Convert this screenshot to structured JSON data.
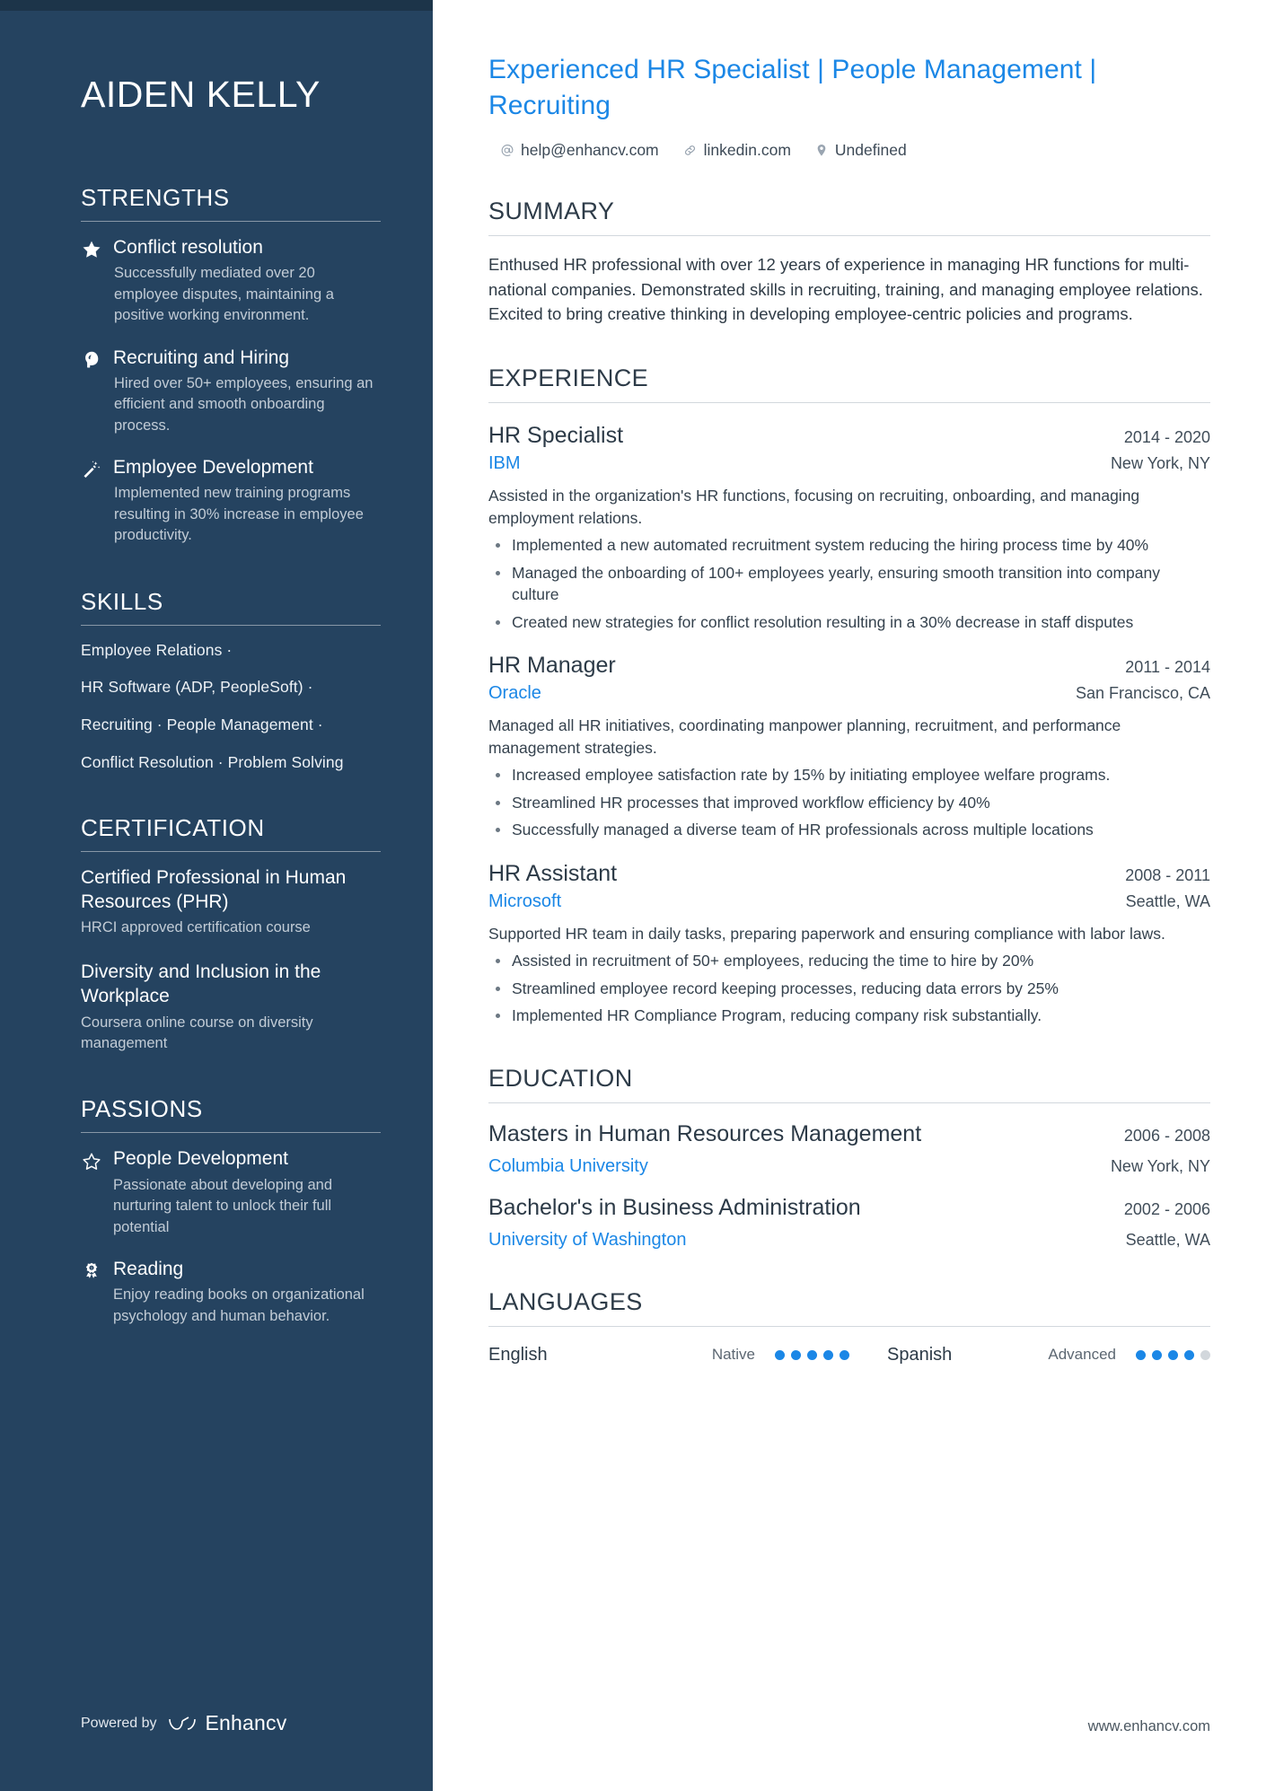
{
  "sidebar": {
    "name": "AIDEN KELLY",
    "strengths": {
      "heading": "STRENGTHS",
      "items": [
        {
          "icon": "star-filled-icon",
          "title": "Conflict resolution",
          "desc": "Successfully mediated over 20 employee disputes, maintaining a positive working environment."
        },
        {
          "icon": "head-brain-icon",
          "title": "Recruiting and Hiring",
          "desc": "Hired over 50+ employees, ensuring an efficient and smooth onboarding process."
        },
        {
          "icon": "magic-wand-icon",
          "title": "Employee Development",
          "desc": "Implemented new training programs resulting in 30% increase in employee productivity."
        }
      ]
    },
    "skills": {
      "heading": "SKILLS",
      "lines": [
        "Employee Relations ·",
        "HR Software (ADP, PeopleSoft) ·",
        "Recruiting · People Management ·",
        "Conflict Resolution · Problem Solving"
      ]
    },
    "certification": {
      "heading": "CERTIFICATION",
      "items": [
        {
          "title": "Certified Professional in Human Resources (PHR)",
          "desc": "HRCI approved certification course"
        },
        {
          "title": "Diversity and Inclusion in the Workplace",
          "desc": "Coursera online course on diversity management"
        }
      ]
    },
    "passions": {
      "heading": "PASSIONS",
      "items": [
        {
          "icon": "star-outline-icon",
          "title": "People Development",
          "desc": "Passionate about developing and nurturing talent to unlock their full potential"
        },
        {
          "icon": "award-ribbon-icon",
          "title": "Reading",
          "desc": "Enjoy reading books on organizational psychology and human behavior."
        }
      ]
    },
    "footer": {
      "powered_by": "Powered by",
      "brand": "Enhancv"
    }
  },
  "main": {
    "headline": "Experienced HR Specialist | People Management | Recruiting",
    "contacts": [
      {
        "icon": "at-icon",
        "text": "help@enhancv.com"
      },
      {
        "icon": "link-icon",
        "text": "linkedin.com"
      },
      {
        "icon": "location-pin-icon",
        "text": "Undefined"
      }
    ],
    "summary": {
      "heading": "SUMMARY",
      "text": "Enthused HR professional with over 12 years of experience in managing HR functions for multi-national companies. Demonstrated skills in recruiting, training, and managing employee relations. Excited to bring creative thinking in developing employee-centric policies and programs."
    },
    "experience": {
      "heading": "EXPERIENCE",
      "entries": [
        {
          "title": "HR Specialist",
          "date": "2014 - 2020",
          "org": "IBM",
          "location": "New York, NY",
          "desc": "Assisted in the organization's HR functions, focusing on recruiting, onboarding, and managing employment relations.",
          "bullets": [
            "Implemented a new automated recruitment system reducing the hiring process time by 40%",
            "Managed the onboarding of 100+ employees yearly, ensuring smooth transition into company culture",
            "Created new strategies for conflict resolution resulting in a 30% decrease in staff disputes"
          ]
        },
        {
          "title": "HR Manager",
          "date": "2011 - 2014",
          "org": "Oracle",
          "location": "San Francisco, CA",
          "desc": "Managed all HR initiatives, coordinating manpower planning, recruitment, and performance management strategies.",
          "bullets": [
            "Increased employee satisfaction rate by 15% by initiating employee welfare programs.",
            "Streamlined HR processes that improved workflow efficiency by 40%",
            "Successfully managed a diverse team of HR professionals across multiple locations"
          ]
        },
        {
          "title": "HR Assistant",
          "date": "2008 - 2011",
          "org": "Microsoft",
          "location": "Seattle, WA",
          "desc": "Supported HR team in daily tasks, preparing paperwork and ensuring compliance with labor laws.",
          "bullets": [
            "Assisted in recruitment of 50+ employees, reducing the time to hire by 20%",
            "Streamlined employee record keeping processes, reducing data errors by 25%",
            "Implemented HR Compliance Program, reducing company risk substantially."
          ]
        }
      ]
    },
    "education": {
      "heading": "EDUCATION",
      "entries": [
        {
          "title": "Masters in Human Resources Management",
          "date": "2006 - 2008",
          "org": "Columbia University",
          "location": "New York, NY"
        },
        {
          "title": "Bachelor's in Business Administration",
          "date": "2002 - 2006",
          "org": "University of Washington",
          "location": "Seattle, WA"
        }
      ]
    },
    "languages": {
      "heading": "LANGUAGES",
      "items": [
        {
          "name": "English",
          "level": "Native",
          "filled": 5,
          "total": 5
        },
        {
          "name": "Spanish",
          "level": "Advanced",
          "filled": 4,
          "total": 5
        }
      ]
    },
    "footer_url": "www.enhancv.com"
  },
  "colors": {
    "sidebar_bg": "#254360",
    "sidebar_topstrip": "#1c3449",
    "accent_blue": "#1b87e6",
    "body_text": "#2f3b46"
  }
}
